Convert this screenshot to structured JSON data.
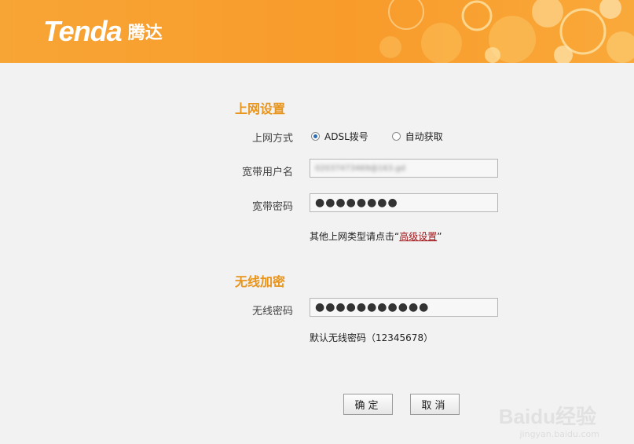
{
  "header": {
    "logo_en": "Tenda",
    "logo_cn": "腾达",
    "colors": {
      "bg": "#f89b2b",
      "text": "#ffffff"
    }
  },
  "internet": {
    "title": "上网设置",
    "mode_label": "上网方式",
    "mode_options": [
      {
        "label": "ADSL拨号",
        "selected": true
      },
      {
        "label": "自动获取",
        "selected": false
      }
    ],
    "username_label": "宽带用户名",
    "username_value": "02037473469@163.gd",
    "password_label": "宽带密码",
    "password_value": "●●●●●●●●",
    "hint_prefix": "其他上网类型请点击“",
    "hint_link": "高级设置",
    "hint_suffix": "”"
  },
  "wireless": {
    "title": "无线加密",
    "password_label": "无线密码",
    "password_value": "●●●●●●●●●●●",
    "default_hint": "默认无线密码（12345678）"
  },
  "buttons": {
    "ok": "确定",
    "cancel": "取消"
  },
  "watermark": {
    "main": "Baidu经验",
    "sub": "jingyan.baidu.com"
  },
  "colors": {
    "section_title": "#e8951e",
    "link": "#a4161a"
  }
}
